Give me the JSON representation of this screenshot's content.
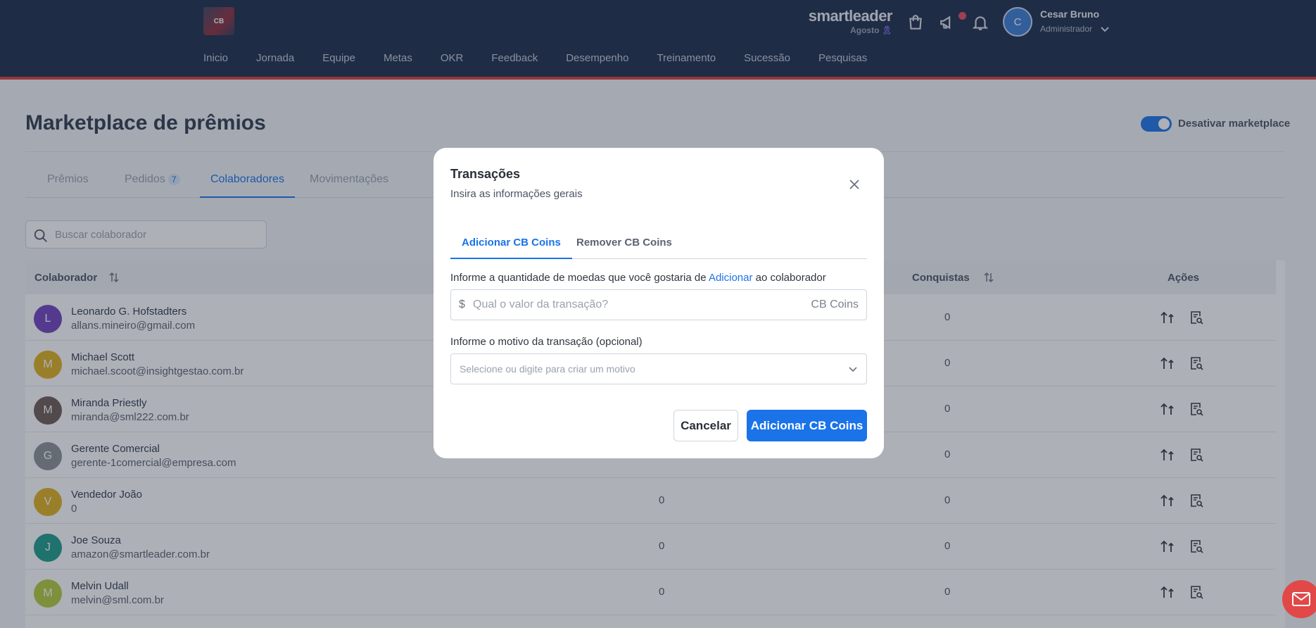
{
  "header": {
    "logo_text": "CB",
    "nav": [
      "Inicio",
      "Jornada",
      "Equipe",
      "Metas",
      "OKR",
      "Feedback",
      "Desempenho",
      "Treinamento",
      "Sucessão",
      "Pesquisas"
    ],
    "brand": "smartleader",
    "brand_month": "Agosto",
    "brand_ribbon": "🎗",
    "user_initial": "C",
    "user_name": "Cesar Bruno",
    "user_role": "Administrador"
  },
  "page": {
    "title": "Marketplace de prêmios",
    "toggle_label": "Desativar marketplace",
    "toggle_on": true,
    "tabs": [
      {
        "label": "Prêmios"
      },
      {
        "label": "Pedidos",
        "badge": "7"
      },
      {
        "label": "Colaboradores"
      },
      {
        "label": "Movimentações"
      }
    ],
    "search_placeholder": "Buscar colaborador"
  },
  "table": {
    "headers": {
      "colaborador": "Colaborador",
      "conquistas": "Conquistas",
      "acoes": "Ações"
    },
    "rows": [
      {
        "initial": "L",
        "color": "#6f42c1",
        "name": "Leonardo G. Hofstadters",
        "email": "allans.mineiro@gmail.com",
        "col1": "",
        "conquistas": "0"
      },
      {
        "initial": "M",
        "color": "#e0b11e",
        "name": "Michael Scott",
        "email": "michael.scoot@insightgestao.com.br",
        "col1": "",
        "conquistas": "0"
      },
      {
        "initial": "M",
        "color": "#6d5a55",
        "name": "Miranda Priestly",
        "email": "miranda@sml222.com.br",
        "col1": "",
        "conquistas": "0"
      },
      {
        "initial": "G",
        "color": "#8c9097",
        "name": "Gerente Comercial",
        "email": "gerente-1comercial@empresa.com",
        "col1": "",
        "conquistas": "0"
      },
      {
        "initial": "V",
        "color": "#e0b11e",
        "name": "Vendedor João",
        "email": "0",
        "col1": "0",
        "conquistas": "0"
      },
      {
        "initial": "J",
        "color": "#1a9c8c",
        "name": "Joe Souza",
        "email": "amazon@smartleader.com.br",
        "col1": "0",
        "conquistas": "0"
      },
      {
        "initial": "M",
        "color": "#b5cc3a",
        "name": "Melvin Udall",
        "email": "melvin@sml.com.br",
        "col1": "0",
        "conquistas": "0"
      }
    ]
  },
  "modal": {
    "title": "Transações",
    "subtitle": "Insira as informações gerais",
    "tabs": [
      "Adicionar CB Coins",
      "Remover CB Coins"
    ],
    "amount_label_prefix": "Informe a quantidade de moedas que você gostaria de",
    "amount_label_action": "Adicionar",
    "amount_label_suffix": "ao colaborador",
    "amount_currency": "$",
    "amount_placeholder": "Qual o valor da transação?",
    "amount_suffix": "CB Coins",
    "reason_label": "Informe o motivo da transação (opcional)",
    "reason_placeholder": "Selecione ou digite para criar um motivo",
    "cancel_label": "Cancelar",
    "submit_label": "Adicionar CB Coins"
  },
  "colors": {
    "accent": "#1a73e8",
    "header_bg": "#1b2a4a",
    "header_border": "#d83a3a"
  }
}
